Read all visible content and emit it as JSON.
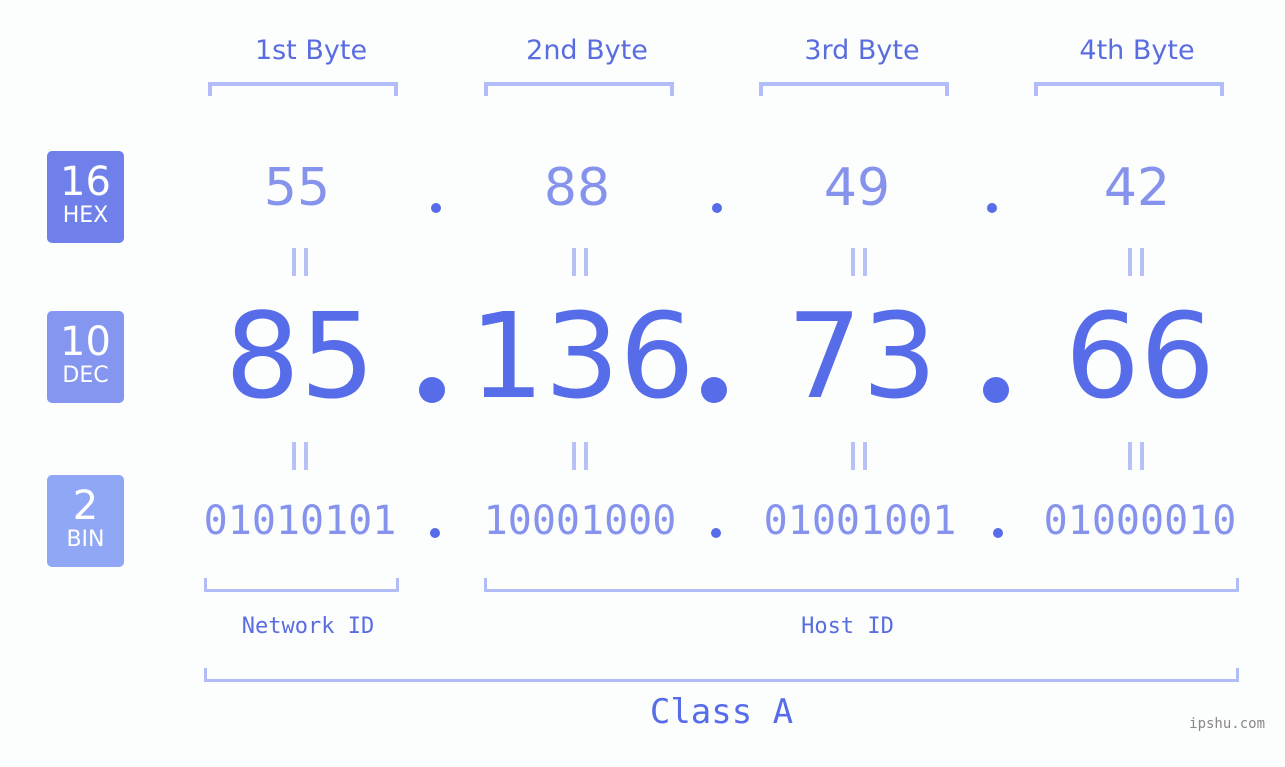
{
  "badges": {
    "hex": {
      "number": "16",
      "label": "HEX",
      "color": "#7080ea"
    },
    "dec": {
      "number": "10",
      "label": "DEC",
      "color": "#8596f0"
    },
    "bin": {
      "number": "2",
      "label": "BIN",
      "color": "#8fa7f5"
    }
  },
  "bytes": [
    {
      "header": "1st Byte",
      "hex": "55",
      "dec": "85",
      "bin": "01010101"
    },
    {
      "header": "2nd Byte",
      "hex": "88",
      "dec": "136",
      "bin": "10001000"
    },
    {
      "header": "3rd Byte",
      "hex": "49",
      "dec": "73",
      "bin": "01001001"
    },
    {
      "header": "4th Byte",
      "hex": "42",
      "dec": "66",
      "bin": "01000010"
    }
  ],
  "labels": {
    "network_id": "Network ID",
    "host_id": "Host ID",
    "ip_class": "Class A"
  },
  "watermark": "ipshu.com",
  "colors": {
    "primary": "#566ce8",
    "light": "#8693ec",
    "bracket": "#b2bcf6"
  }
}
